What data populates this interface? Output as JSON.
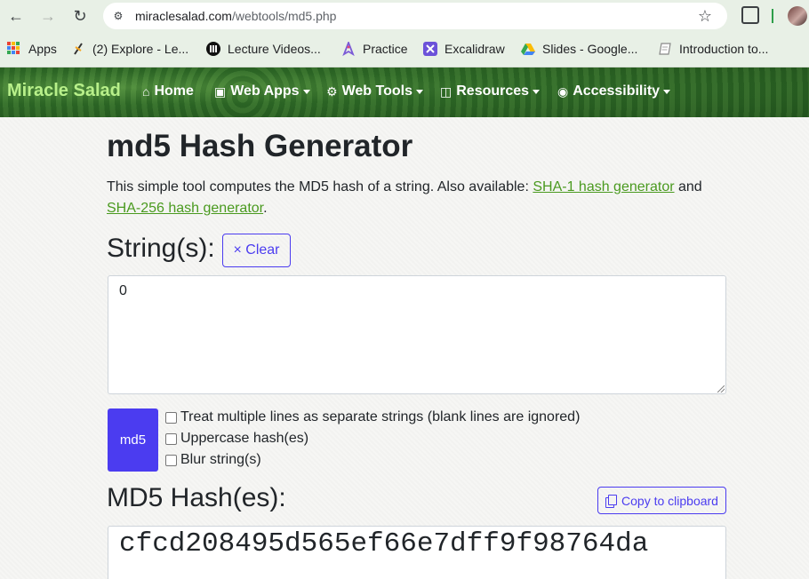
{
  "browser": {
    "url_host": "miraclesalad.com",
    "url_path": "/webtools/md5.php",
    "bookmarks": [
      {
        "label": "Apps",
        "icon": "apps-grid-icon"
      },
      {
        "label": "(2) Explore - Le...",
        "icon": "explore-icon"
      },
      {
        "label": "Lecture Videos...",
        "icon": "lecture-icon"
      },
      {
        "label": "Practice",
        "icon": "practice-icon"
      },
      {
        "label": "Excalidraw",
        "icon": "excalidraw-icon"
      },
      {
        "label": "Slides - Google...",
        "icon": "google-drive-icon"
      },
      {
        "label": "Introduction to...",
        "icon": "page-icon"
      }
    ]
  },
  "navbar": {
    "brand": "Miracle Salad",
    "items": [
      {
        "label": "Home",
        "icon": "home-icon",
        "dropdown": false
      },
      {
        "label": "Web Apps",
        "icon": "briefcase-icon",
        "dropdown": true
      },
      {
        "label": "Web Tools",
        "icon": "cogs-icon",
        "dropdown": true
      },
      {
        "label": "Resources",
        "icon": "gift-icon",
        "dropdown": true
      },
      {
        "label": "Accessibility",
        "icon": "universal-access-icon",
        "dropdown": true
      }
    ]
  },
  "main": {
    "title": "md5 Hash Generator",
    "intro_text": "This simple tool computes the MD5 hash of a string. Also available: ",
    "intro_link1": "SHA-1 hash generator",
    "intro_and": " and ",
    "intro_link2": "SHA-256 hash generator",
    "intro_end": ".",
    "strings_label": "String(s):",
    "clear_label": "× Clear",
    "input_value": "0",
    "md5_button": "md5",
    "options": [
      {
        "label": "Treat multiple lines as separate strings (blank lines are ignored)",
        "checked": false
      },
      {
        "label": "Uppercase hash(es)",
        "checked": false
      },
      {
        "label": "Blur string(s)",
        "checked": false
      }
    ],
    "hashes_label": "MD5 Hash(es):",
    "copy_label": "Copy to clipboard",
    "hash_output": "cfcd208495d565ef66e7dff9f98764da"
  },
  "colors": {
    "accent": "#4b3cf0",
    "link": "#4a9a1f",
    "brand": "#b8f08a",
    "navbar": "#2f6b27"
  }
}
